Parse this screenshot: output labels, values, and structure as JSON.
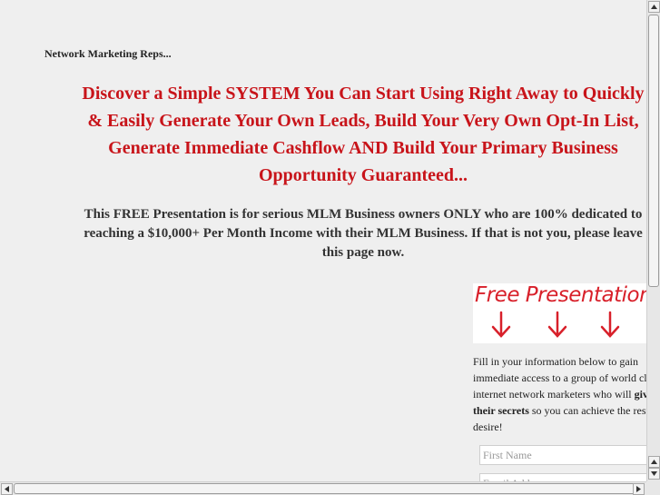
{
  "page": {
    "kicker": "Network Marketing Reps...",
    "headline": [
      "Discover a Simple SYSTEM You Can Start Using Right Away to Quickly",
      "& Easily Generate Your Own Leads, Build Your Very Own Opt-In List,",
      "Generate Immediate Cashflow AND Build Your Primary Business",
      "Opportunity Guaranteed..."
    ],
    "subheadline": [
      "This FREE Presentation is for serious MLM Business owners ONLY who are 100% dedicated to",
      "reaching a $10,000+ Per Month Income with their MLM Business. If that is not you, please leave",
      "this page now."
    ]
  },
  "optin": {
    "banner_title": "Free Presentation",
    "banner_color": "#d8202a",
    "description": {
      "line1": "Fill in your information below to gain",
      "line2": "immediate access to a group of world class",
      "line3_pre": "internet network marketers who will ",
      "line3_bold": "give",
      "line4_bold": "their secrets",
      "line4_post": " so you can achieve the results you",
      "line5": "desire!"
    },
    "first_name_placeholder": "First Name",
    "email_placeholder": "Email Address"
  },
  "colors": {
    "headline": "#c8141a",
    "background": "#efefef"
  },
  "icons": {
    "banner_arrows": "down-arrow-icon",
    "scroll_up": "chevron-up-icon",
    "scroll_down": "chevron-down-icon",
    "scroll_left": "chevron-left-icon",
    "scroll_right": "chevron-right-icon"
  }
}
